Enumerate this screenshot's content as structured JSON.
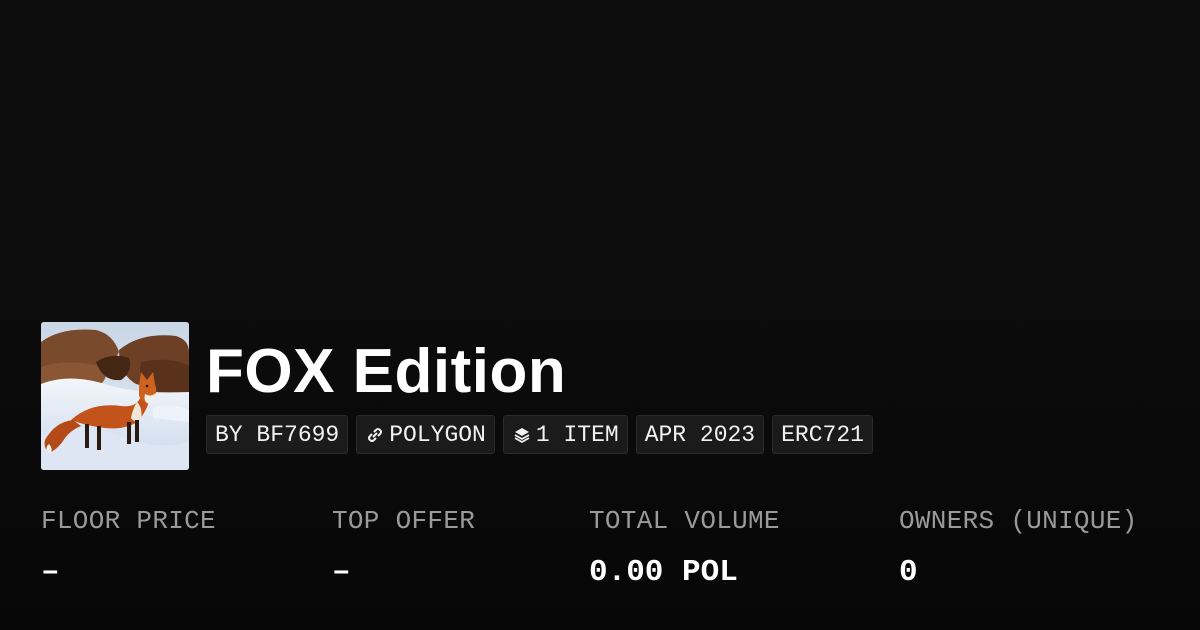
{
  "collection": {
    "title": "FOX Edition",
    "avatar_alt": "fox-in-snow-image"
  },
  "chips": [
    {
      "label": "BY BF7699",
      "icon": null
    },
    {
      "label": "POLYGON",
      "icon": "chain-link-icon"
    },
    {
      "label": "1 ITEM",
      "icon": "layers-icon"
    },
    {
      "label": "APR 2023",
      "icon": null
    },
    {
      "label": "ERC721",
      "icon": null
    }
  ],
  "stats": [
    {
      "label": "FLOOR PRICE",
      "value": "–"
    },
    {
      "label": "TOP OFFER",
      "value": "–"
    },
    {
      "label": "TOTAL VOLUME",
      "value": "0.00 POL"
    },
    {
      "label": "OWNERS (UNIQUE)",
      "value": "0"
    }
  ],
  "colors": {
    "background": "#0b0b0b",
    "chip_bg": "#1b1b1b",
    "label_gray": "#9a9a9a",
    "text": "#ffffff"
  }
}
